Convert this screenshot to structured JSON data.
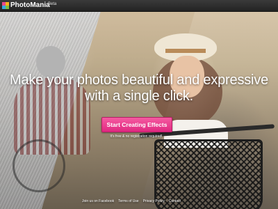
{
  "header": {
    "brand": "PhotoMania",
    "badge": "Beta"
  },
  "hero": {
    "headline_line1": "Make your photos beautiful and expressive",
    "headline_line2": "with a single click.",
    "cta_label": "Start Creating Effects",
    "subtext": "It's free & no registration required!"
  },
  "footer": {
    "links": [
      "Join us on Facebook",
      "Terms of Use",
      "Privacy Policy",
      "Contact"
    ]
  },
  "colors": {
    "accent": "#e8388c",
    "topbar": "#2b2b2b"
  },
  "icons": {
    "logo": "photomania-logo-icon"
  }
}
